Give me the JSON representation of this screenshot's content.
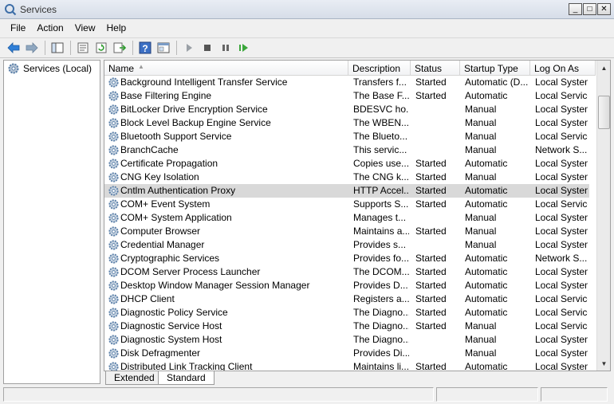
{
  "window": {
    "title": "Services",
    "minimize": "_",
    "maximize": "□",
    "close": "✕"
  },
  "menu": [
    "File",
    "Action",
    "View",
    "Help"
  ],
  "toolbar_icons": [
    "back-arrow-icon",
    "forward-arrow-icon",
    "show-tree-icon",
    "properties-icon",
    "refresh-icon",
    "export-list-icon",
    "help-icon",
    "console-tree-icon",
    "start-service-icon",
    "stop-service-icon",
    "pause-service-icon",
    "restart-service-icon"
  ],
  "tree": {
    "root_label": "Services (Local)"
  },
  "columns": {
    "name": "Name",
    "description": "Description",
    "status": "Status",
    "startup": "Startup Type",
    "logon": "Log On As"
  },
  "rows": [
    {
      "name": "Background Intelligent Transfer Service",
      "description": "Transfers f...",
      "status": "Started",
      "startup": "Automatic (D...",
      "logon": "Local System"
    },
    {
      "name": "Base Filtering Engine",
      "description": "The Base F...",
      "status": "Started",
      "startup": "Automatic",
      "logon": "Local Service"
    },
    {
      "name": "BitLocker Drive Encryption Service",
      "description": "BDESVC ho...",
      "status": "",
      "startup": "Manual",
      "logon": "Local System"
    },
    {
      "name": "Block Level Backup Engine Service",
      "description": "The WBEN...",
      "status": "",
      "startup": "Manual",
      "logon": "Local System"
    },
    {
      "name": "Bluetooth Support Service",
      "description": "The Blueto...",
      "status": "",
      "startup": "Manual",
      "logon": "Local Service"
    },
    {
      "name": "BranchCache",
      "description": "This servic...",
      "status": "",
      "startup": "Manual",
      "logon": "Network S..."
    },
    {
      "name": "Certificate Propagation",
      "description": "Copies use...",
      "status": "Started",
      "startup": "Automatic",
      "logon": "Local System"
    },
    {
      "name": "CNG Key Isolation",
      "description": "The CNG k...",
      "status": "Started",
      "startup": "Manual",
      "logon": "Local System"
    },
    {
      "name": "Cntlm Authentication Proxy",
      "description": "HTTP Accel...",
      "status": "Started",
      "startup": "Automatic",
      "logon": "Local System"
    },
    {
      "name": "COM+ Event System",
      "description": "Supports S...",
      "status": "Started",
      "startup": "Automatic",
      "logon": "Local Service"
    },
    {
      "name": "COM+ System Application",
      "description": "Manages t...",
      "status": "",
      "startup": "Manual",
      "logon": "Local System"
    },
    {
      "name": "Computer Browser",
      "description": "Maintains a...",
      "status": "Started",
      "startup": "Manual",
      "logon": "Local System"
    },
    {
      "name": "Credential Manager",
      "description": "Provides s...",
      "status": "",
      "startup": "Manual",
      "logon": "Local System"
    },
    {
      "name": "Cryptographic Services",
      "description": "Provides fo...",
      "status": "Started",
      "startup": "Automatic",
      "logon": "Network S..."
    },
    {
      "name": "DCOM Server Process Launcher",
      "description": "The DCOM...",
      "status": "Started",
      "startup": "Automatic",
      "logon": "Local System"
    },
    {
      "name": "Desktop Window Manager Session Manager",
      "description": "Provides D...",
      "status": "Started",
      "startup": "Automatic",
      "logon": "Local System"
    },
    {
      "name": "DHCP Client",
      "description": "Registers a...",
      "status": "Started",
      "startup": "Automatic",
      "logon": "Local Service"
    },
    {
      "name": "Diagnostic Policy Service",
      "description": "The Diagno...",
      "status": "Started",
      "startup": "Automatic",
      "logon": "Local Service"
    },
    {
      "name": "Diagnostic Service Host",
      "description": "The Diagno...",
      "status": "Started",
      "startup": "Manual",
      "logon": "Local Service"
    },
    {
      "name": "Diagnostic System Host",
      "description": "The Diagno...",
      "status": "",
      "startup": "Manual",
      "logon": "Local System"
    },
    {
      "name": "Disk Defragmenter",
      "description": "Provides Di...",
      "status": "",
      "startup": "Manual",
      "logon": "Local System"
    },
    {
      "name": "Distributed Link Tracking Client",
      "description": "Maintains li...",
      "status": "Started",
      "startup": "Automatic",
      "logon": "Local System"
    }
  ],
  "selected_row": 8,
  "tabs": {
    "extended": "Extended",
    "standard": "Standard",
    "active": "standard"
  },
  "colors": {
    "selected_row": "#d9d9d9",
    "gear": "#5a7fa8",
    "arrow_blue": "#2f7fd8",
    "play_green": "#3aa63a"
  }
}
